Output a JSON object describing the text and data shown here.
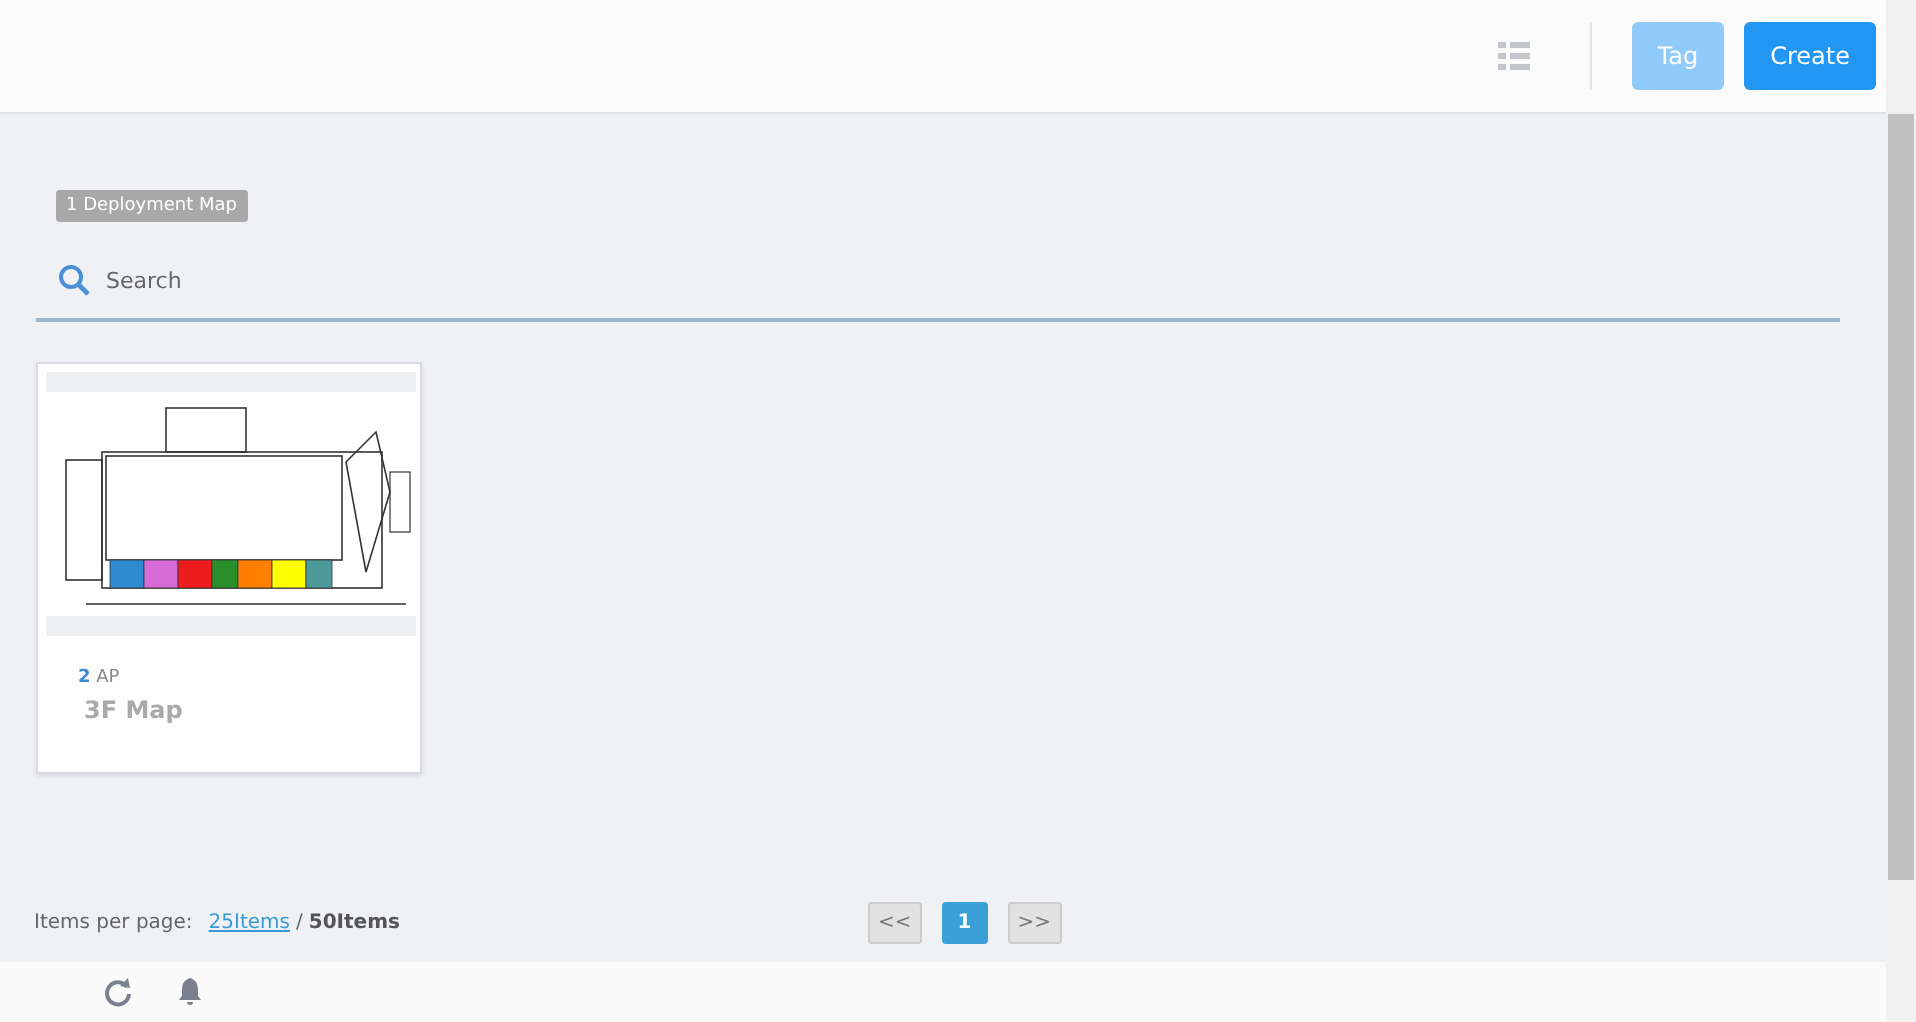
{
  "toolbar": {
    "buttons": [
      {
        "label": "Tag",
        "disabled": true
      },
      {
        "label": "Create",
        "disabled": false
      }
    ]
  },
  "count_badge": "1 Deployment Map",
  "search": {
    "placeholder": "Search"
  },
  "maps": [
    {
      "ap_count": "2",
      "ap_label": "AP",
      "name": "3F Map"
    }
  ],
  "pagination": {
    "label": "Items per page:",
    "separator": "/",
    "page_sizes": [
      {
        "label": "25Items",
        "selected": false
      },
      {
        "label": "50Items",
        "selected": true
      }
    ],
    "prev": "<<",
    "next": ">>",
    "pages": [
      {
        "label": "1",
        "selected": true
      }
    ]
  }
}
